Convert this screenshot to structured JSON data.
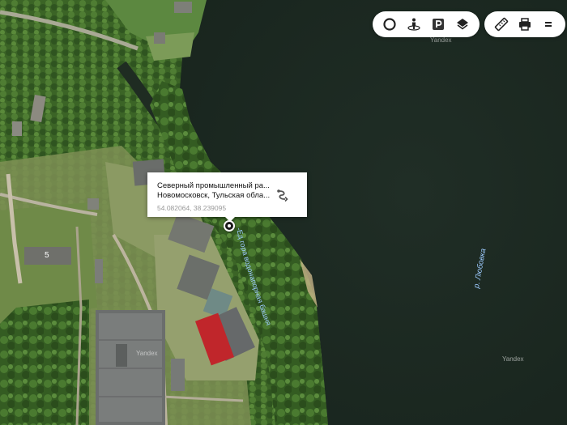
{
  "toolbar_left": [
    {
      "name": "traffic-icon"
    },
    {
      "name": "panorama-icon"
    },
    {
      "name": "parking-icon"
    },
    {
      "name": "layers-icon"
    }
  ],
  "toolbar_right": [
    {
      "name": "ruler-icon"
    },
    {
      "name": "print-icon"
    },
    {
      "name": "menu-icon"
    }
  ],
  "popup": {
    "line1": "Северный промышленный ра...",
    "line2": "Новомосковск, Тульская обла...",
    "coords": "54.082064, 38.239095"
  },
  "map_labels": {
    "river": "р. Любовка",
    "road": "-Ед гора водонапорная башня",
    "building_number": "5"
  },
  "watermarks": [
    "Yandex",
    "Yandex",
    "Yandex"
  ],
  "colors": {
    "water": "#1c2a22",
    "forest": "#3f6a2a",
    "roof_red": "#c0262b",
    "label_blue": "#9ecbff"
  }
}
